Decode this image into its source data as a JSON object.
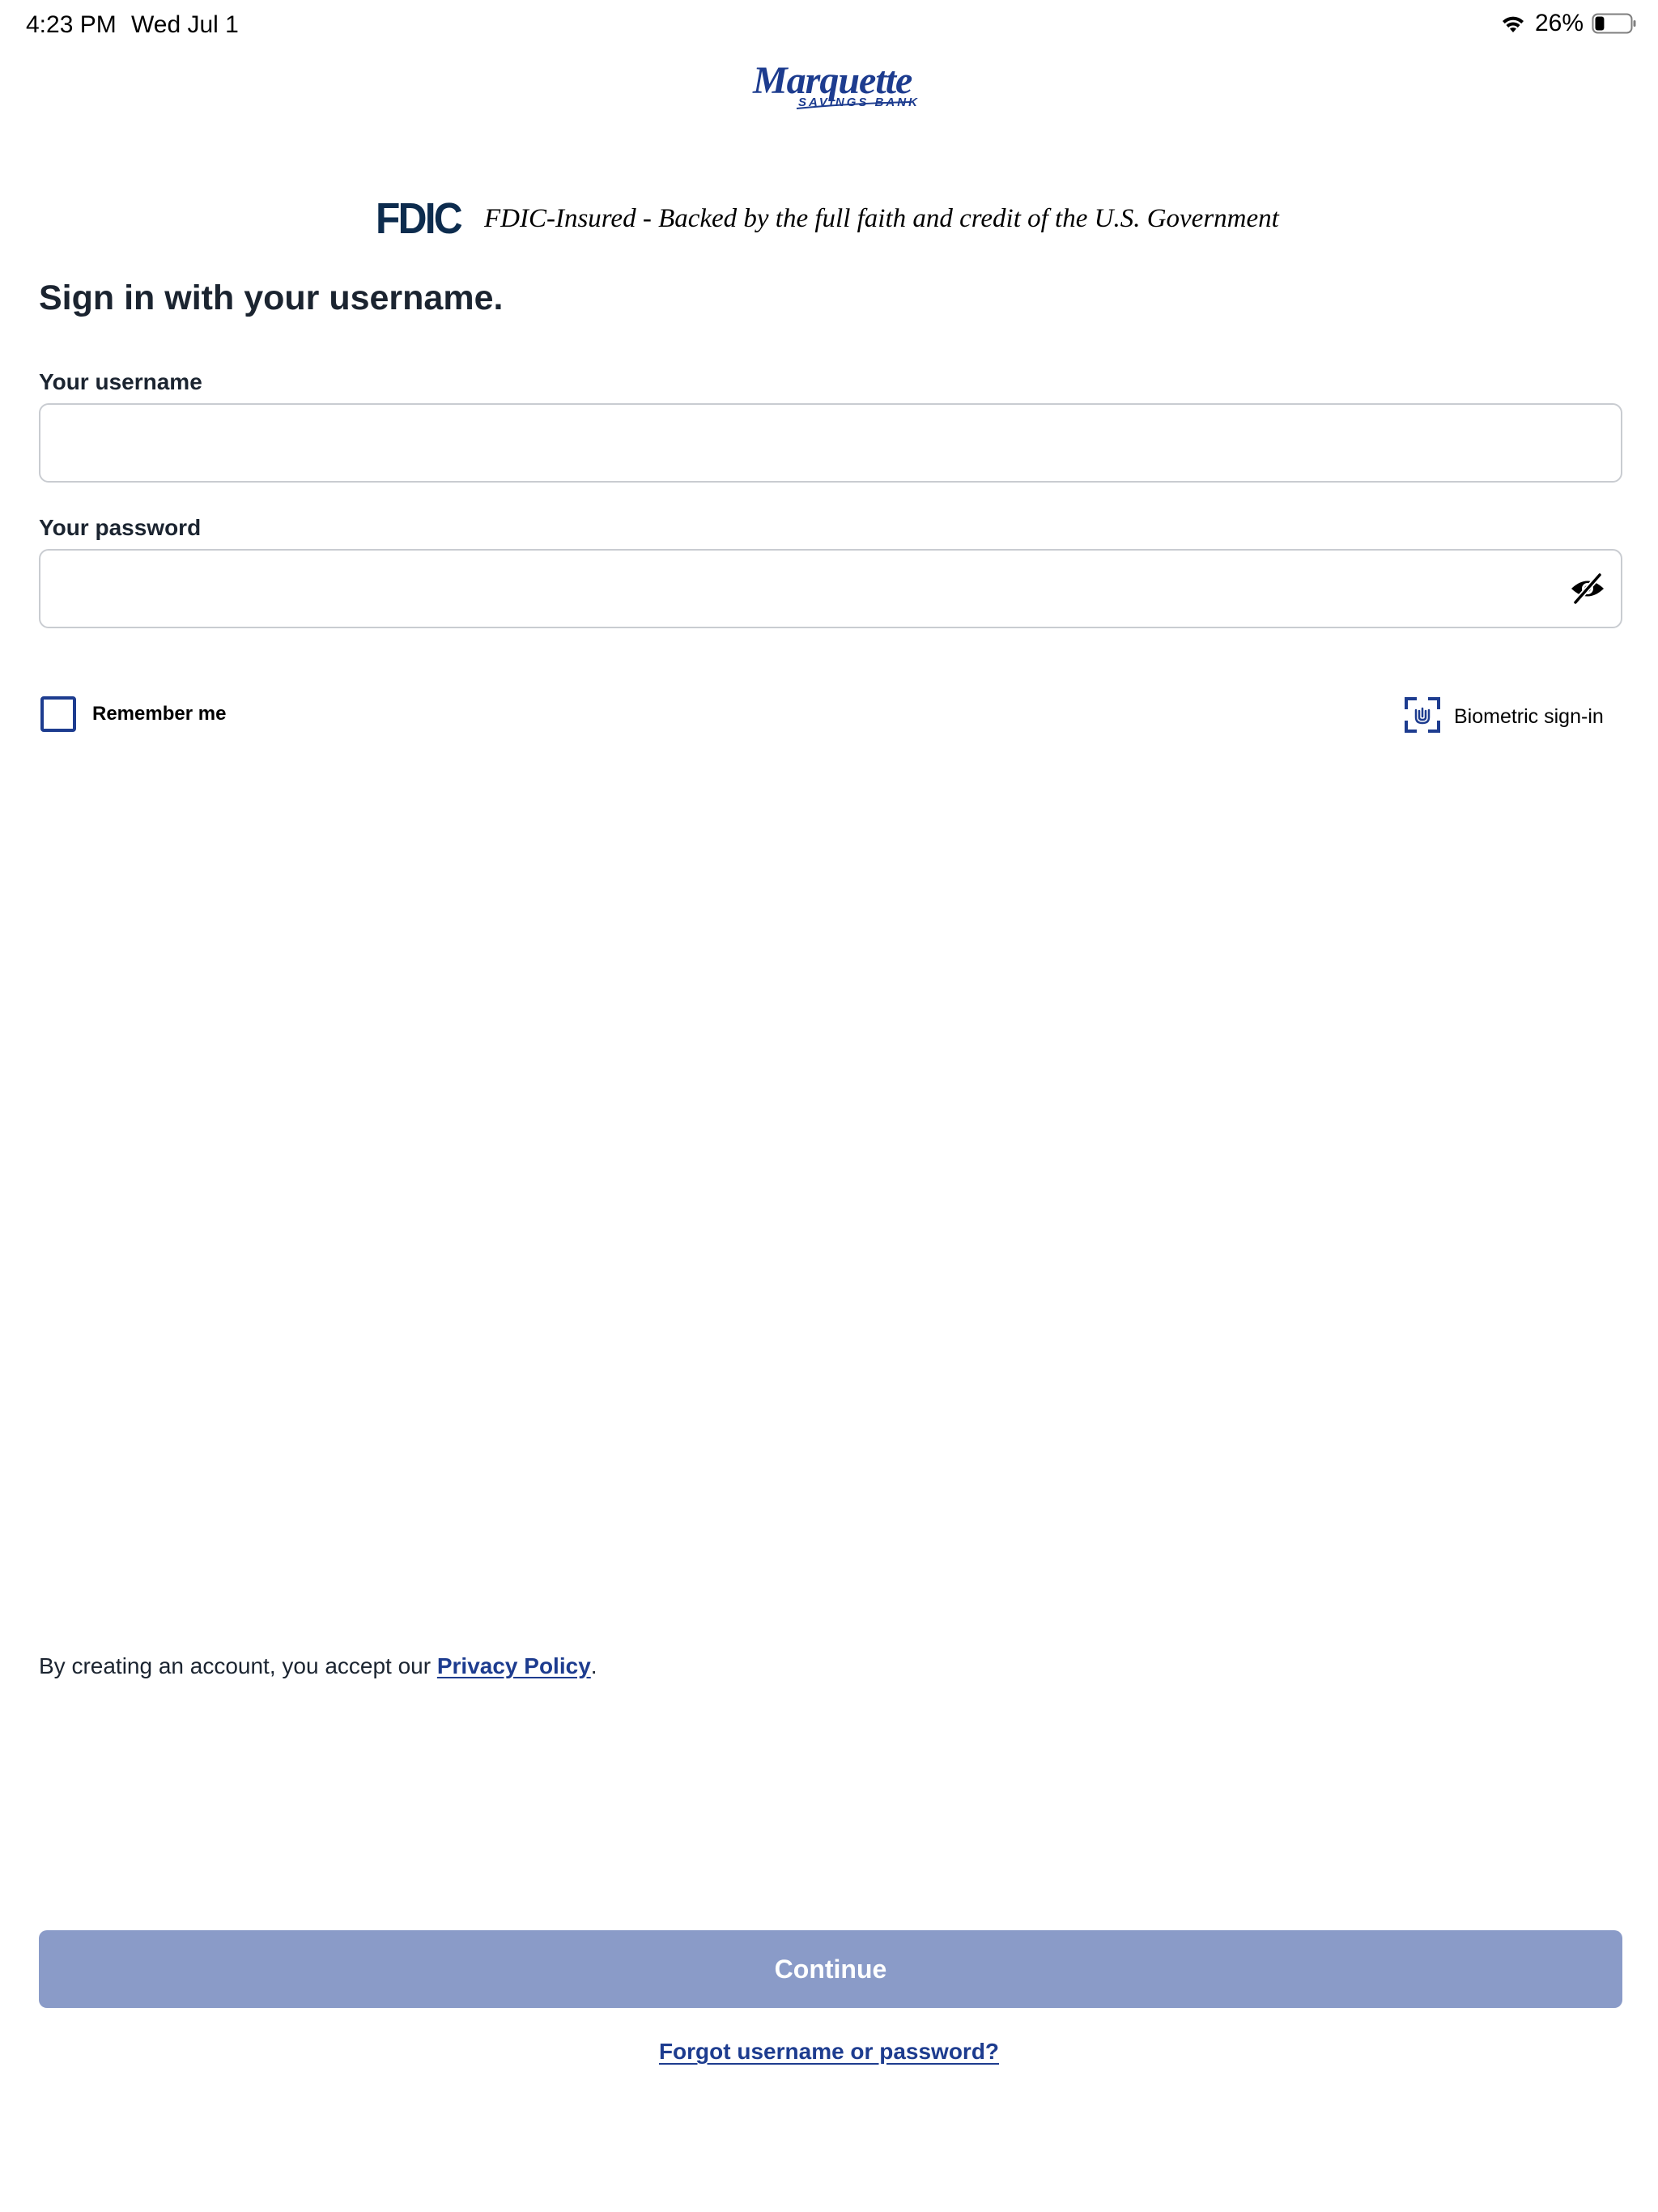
{
  "status_bar": {
    "time": "4:23 PM",
    "date": "Wed Jul 1",
    "battery": "26%",
    "battery_level": 0.26
  },
  "brand": {
    "logo_script": "Marquette",
    "logo_sub": "SAVINGS BANK",
    "color": "#1d3c8f"
  },
  "fdic": {
    "mark": "FDIC",
    "text": "FDIC-Insured - Backed by the full faith and credit of the U.S. Government"
  },
  "form": {
    "heading": "Sign in with your username.",
    "username_label": "Your username",
    "username_value": "",
    "password_label": "Your password",
    "password_value": "",
    "remember_label": "Remember me",
    "remember_checked": false,
    "biometric_label": "Biometric sign-in"
  },
  "footer": {
    "privacy_prefix": "By creating an account, you accept our ",
    "privacy_link": "Privacy Policy",
    "privacy_suffix": ".",
    "continue_label": "Continue",
    "forgot_label": "Forgot username or password?"
  },
  "colors": {
    "accent": "#1d3c8f",
    "button_disabled": "#8a9bc8",
    "fdic": "#0d2c4e"
  },
  "icons": {
    "wifi": "wifi-icon",
    "battery": "battery-icon",
    "eye_toggle": "eye-slash-icon",
    "biometric": "face-id-icon"
  }
}
